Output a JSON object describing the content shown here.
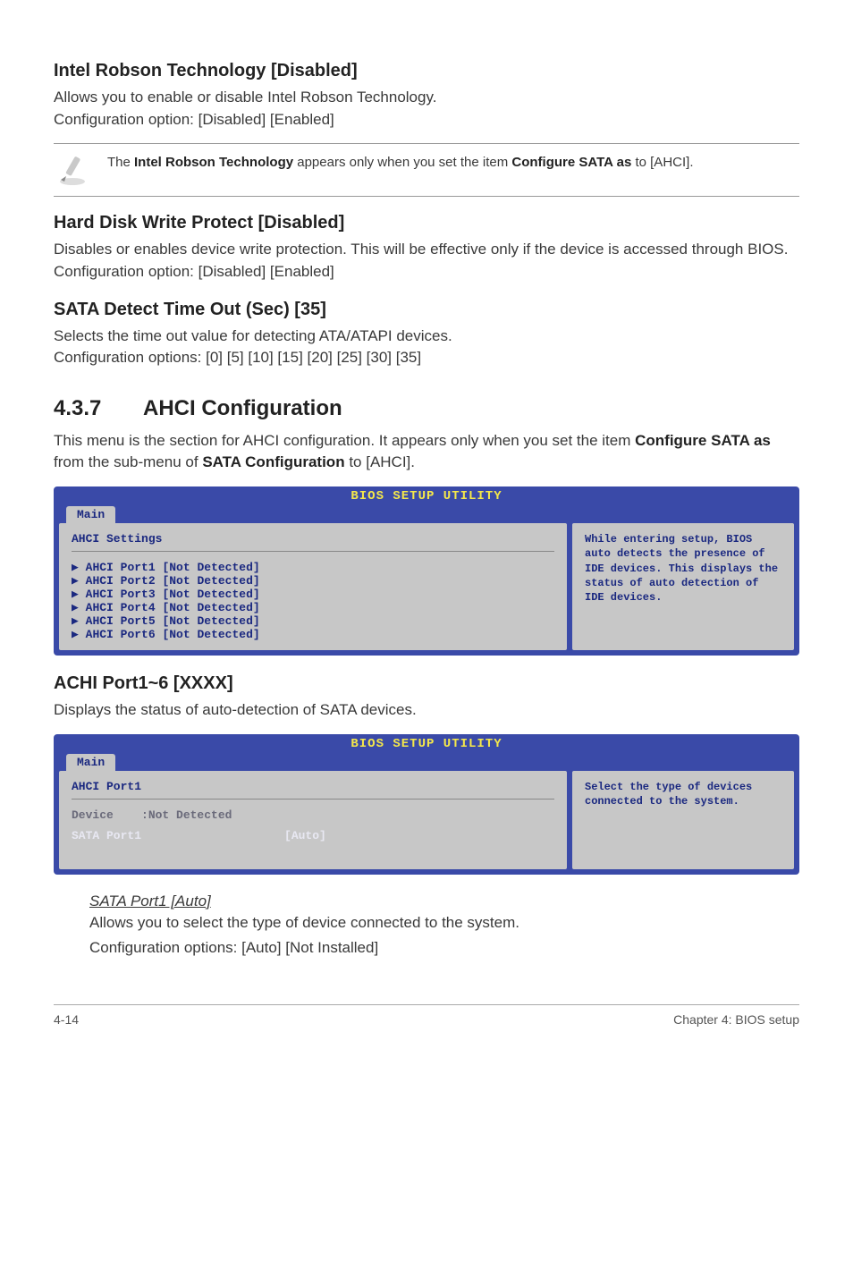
{
  "s1": {
    "title": "Intel Robson Technology [Disabled]",
    "p1": "Allows you to enable or disable Intel Robson Technology.",
    "p2": "Configuration option: [Disabled] [Enabled]"
  },
  "note": {
    "pre": "The ",
    "bold1": "Intel Robson Technology",
    "mid": " appears only when you set the item ",
    "bold2": "Configure SATA as",
    "post": " to [AHCI]."
  },
  "s2": {
    "title": "Hard Disk Write Protect [Disabled]",
    "p": "Disables or enables device write protection. This will be effective only if the device is accessed through BIOS. Configuration option: [Disabled] [Enabled]"
  },
  "s3": {
    "title": "SATA Detect Time Out (Sec) [35]",
    "p1": "Selects the time out value for detecting ATA/ATAPI devices.",
    "p2": "Configuration options: [0] [5] [10] [15] [20] [25] [30] [35]"
  },
  "s4": {
    "num": "4.3.7",
    "title": "AHCI Configuration",
    "p_pre": "This menu is the section for AHCI configuration. It appears only when you set the item ",
    "p_b1": "Configure SATA as",
    "p_mid": " from the sub-menu of ",
    "p_b2": "SATA Configuration",
    "p_post": " to [AHCI]."
  },
  "bios1": {
    "title": "BIOS SETUP UTILITY",
    "tab": "Main",
    "heading": "AHCI Settings",
    "items": [
      "AHCI Port1 [Not Detected]",
      "AHCI Port2 [Not Detected]",
      "AHCI Port3 [Not Detected]",
      "AHCI Port4 [Not Detected]",
      "AHCI Port5 [Not Detected]",
      "AHCI Port6 [Not Detected]"
    ],
    "help": "While entering setup, BIOS auto detects the presence of IDE devices. This displays the status of auto detection of IDE devices."
  },
  "s5": {
    "title": "ACHI Port1~6 [XXXX]",
    "p": "Displays the status of auto-detection of SATA devices."
  },
  "bios2": {
    "title": "BIOS SETUP UTILITY",
    "tab": "Main",
    "heading": "AHCI Port1",
    "row_dev": "Device    :Not Detected",
    "row_sel_l": "SATA Port1",
    "row_sel_r": "[Auto]",
    "help": "Select the type of devices connected to the system."
  },
  "sub": {
    "title": "SATA Port1 [Auto]",
    "p1": "Allows you to select the type of device connected to the system.",
    "p2": "Configuration options: [Auto] [Not Installed]"
  },
  "footer": {
    "left": "4-14",
    "right": "Chapter 4: BIOS setup"
  }
}
